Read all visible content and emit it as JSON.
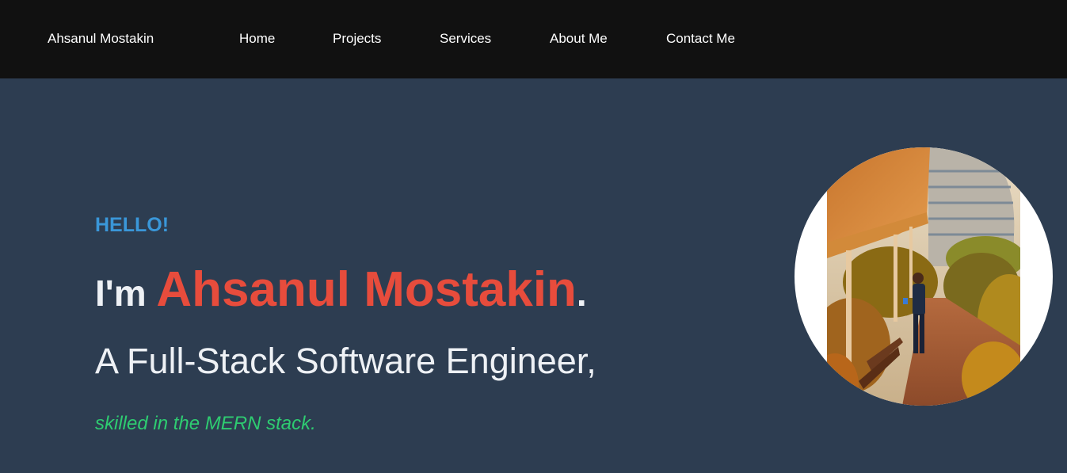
{
  "nav": {
    "brand": "Ahsanul Mostakin",
    "links": [
      "Home",
      "Projects",
      "Services",
      "About Me",
      "Contact Me"
    ]
  },
  "hero": {
    "greeting": "HELLO!",
    "intro_prefix": "I'm ",
    "name": "Ahsanul Mostakin",
    "intro_suffix": ".",
    "role": "A Full-Stack Software Engineer,",
    "skills": "skilled in the MERN stack."
  },
  "colors": {
    "nav_background": "#111111",
    "hero_background": "#2d3d51",
    "greeting": "#3a97d9",
    "name": "#e74c3c",
    "skills": "#2ecc71"
  }
}
